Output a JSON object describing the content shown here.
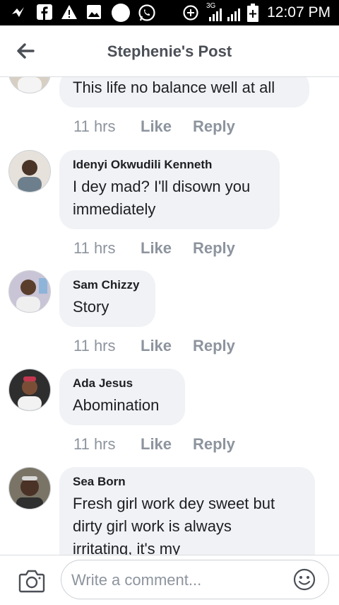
{
  "status_bar": {
    "time": "12:07 PM",
    "network_label": "3G",
    "icons": [
      "messenger-bolt-icon",
      "facebook-icon",
      "warning-icon",
      "image-icon",
      "circle-icon",
      "whatsapp-icon",
      "data-saver-icon",
      "signal-icon",
      "battery-icon"
    ]
  },
  "header": {
    "title": "Stephenie's Post",
    "back_icon": "back-arrow-icon"
  },
  "comments": [
    {
      "author": "",
      "text": "This life no balance well at all",
      "time": "11 hrs",
      "like_label": "Like",
      "reply_label": "Reply",
      "avatar_color": "#c9a27a"
    },
    {
      "author": "Idenyi Okwudili Kenneth",
      "text": "I dey mad? I'll disown you\nimmediately",
      "time": "11 hrs",
      "like_label": "Like",
      "reply_label": "Reply",
      "avatar_color": "#7d6a5c"
    },
    {
      "author": "Sam Chizzy",
      "text": "Story",
      "time": "11 hrs",
      "like_label": "Like",
      "reply_label": "Reply",
      "avatar_color": "#6b4f3a"
    },
    {
      "author": "Ada Jesus",
      "text": "Abomination",
      "time": "11 hrs",
      "like_label": "Like",
      "reply_label": "Reply",
      "avatar_color": "#3b3b3b"
    },
    {
      "author": "Sea Born",
      "text": "Fresh girl work dey sweet but\ndirty girl work is always\nirritating, it's my",
      "time": "",
      "like_label": "",
      "reply_label": "",
      "avatar_color": "#4a3a2e"
    }
  ],
  "composer": {
    "placeholder": "Write a comment...",
    "camera_icon": "camera-icon",
    "emoji_icon": "emoji-icon"
  },
  "colors": {
    "bubble": "#f0f2f5",
    "meta_text": "#8d949e",
    "header_text": "#4b4f56"
  }
}
